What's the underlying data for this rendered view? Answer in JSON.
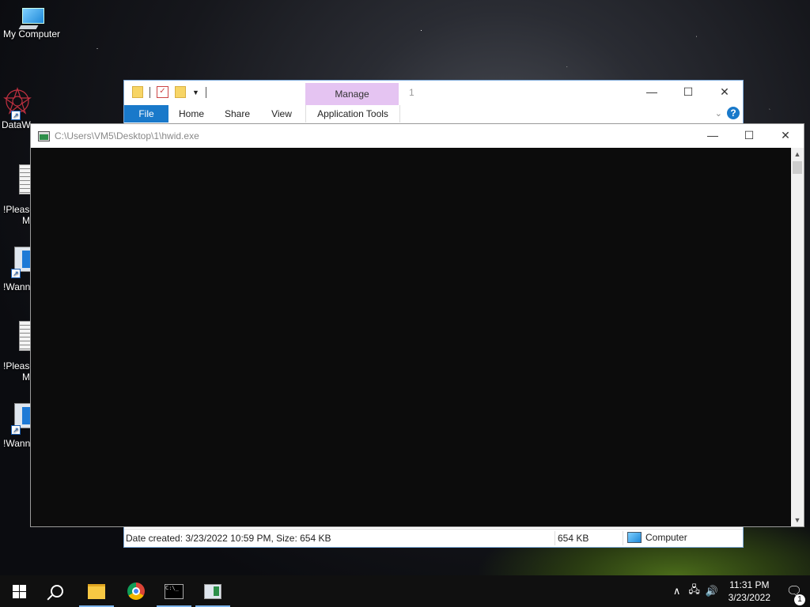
{
  "desktop": {
    "icons": [
      {
        "label": "My Computer"
      },
      {
        "label": "DataW"
      },
      {
        "label": "!Please",
        "label2": "M"
      },
      {
        "label": "!Wann"
      },
      {
        "label": "!Please",
        "label2": "M"
      },
      {
        "label": "!Wann"
      }
    ]
  },
  "explorer": {
    "title": "1",
    "context_tab": "Manage",
    "tabs": {
      "file": "File",
      "home": "Home",
      "share": "Share",
      "view": "View",
      "app_tools": "Application Tools"
    },
    "help": "?",
    "status": {
      "details": "Date created: 3/23/2022 10:59 PM, Size: 654 KB",
      "size": "654 KB",
      "location": "Computer"
    }
  },
  "console": {
    "title": "C:\\Users\\VM5\\Desktop\\1\\hwid.exe",
    "background_color": "#0c0c0c"
  },
  "window_controls": {
    "minimize": "—",
    "maximize": "☐",
    "close": "✕"
  },
  "taskbar": {
    "items": [
      "start-icon",
      "search-icon",
      "file-explorer-icon",
      "chrome-icon",
      "cmd-icon",
      "hwid-app-icon"
    ],
    "tray": {
      "time": "11:31 PM",
      "date": "3/23/2022",
      "notifications": "1"
    }
  }
}
